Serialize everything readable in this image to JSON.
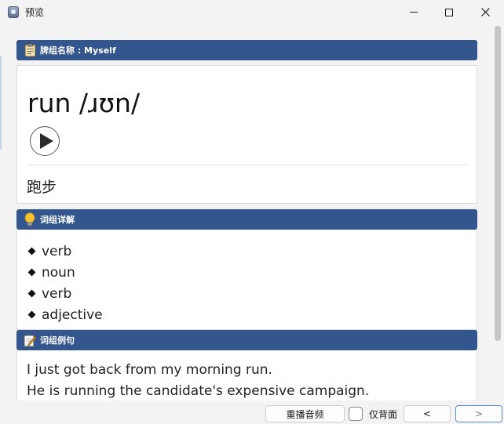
{
  "window": {
    "title": "预览",
    "icon": "app-icon",
    "controls": [
      "minimize-icon",
      "maximize-icon",
      "close-icon"
    ]
  },
  "deck": {
    "header_label": "牌组名称 : Myself",
    "icon": "clipboard-icon"
  },
  "word_card": {
    "word": "run /ɹʊn/",
    "play_icon": "play-icon",
    "meaning": "跑步"
  },
  "details": {
    "header_label": "词组详解",
    "icon": "lightbulb-icon",
    "parts_of_speech": [
      "verb",
      "noun",
      "verb",
      "adjective"
    ]
  },
  "examples": {
    "header_label": "词组例句",
    "icon": "pencil-note-icon",
    "sentences": [
      "I just got back from my morning run.",
      "He is running the candidate's expensive campaign."
    ]
  },
  "bottom": {
    "replay_label": "重播音频",
    "back_only_label": "仅背面",
    "back_only_checked": false,
    "prev_label": "<",
    "next_label": ">"
  },
  "colors": {
    "header_bg": "#34568f",
    "next_button_border": "#5b8ed6"
  }
}
